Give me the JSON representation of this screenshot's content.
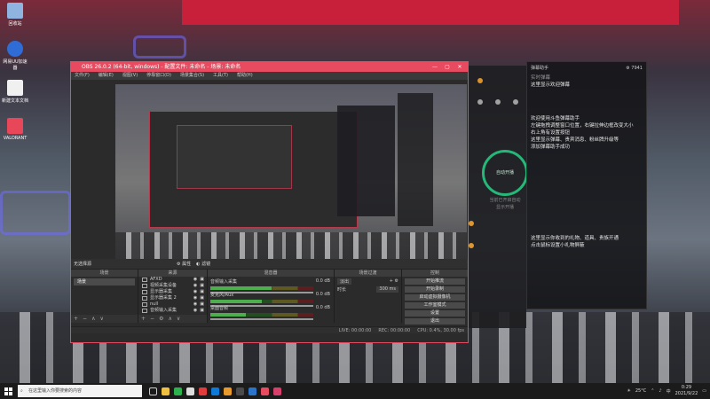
{
  "desktop": {
    "icons": [
      {
        "label": "回收站",
        "color": "#8fb4e0"
      },
      {
        "label": "网易UU加速器",
        "color": "#2f6cd6"
      },
      {
        "label": "新建文本文档",
        "color": "#f0f0f0"
      },
      {
        "label": "VALORANT",
        "color": "#e8475a"
      }
    ]
  },
  "obs": {
    "title": "OBS 26.0.2 (64-bit, windows) - 配置文件: 未命名 - 场景: 未命名",
    "window_controls": [
      "—",
      "▢",
      "✕"
    ],
    "menu": [
      "文件(F)",
      "编辑(E)",
      "视图(V)",
      "停靠窗口(D)",
      "场景集合(S)",
      "工具(T)",
      "帮助(H)"
    ],
    "scene_bar_label": "无选择源",
    "scene_bar_props": "属性",
    "scene_bar_filters": "滤镜",
    "docks": {
      "scenes": {
        "header": "场景",
        "items": [
          "场景"
        ]
      },
      "sources": {
        "header": "来源",
        "items": [
          "AFXD",
          "视频采集设备",
          "显示器采集",
          "显示器采集 2",
          "null",
          "音频输入采集"
        ]
      },
      "mixer": {
        "header": "混音器",
        "rows": [
          {
            "name": "音频输入采集",
            "value": "0.0 dB",
            "level": 0.6
          },
          {
            "name": "麦克风/Aux",
            "value": "0.0 dB",
            "level": 0.5
          },
          {
            "name": "桌面音频",
            "value": "0.0 dB",
            "level": 0.35
          }
        ]
      },
      "transitions": {
        "header": "场景过渡",
        "type": "淡出",
        "duration_label": "时长",
        "duration_value": "300 ms"
      },
      "controls": {
        "header": "控制",
        "buttons": [
          "开始推流",
          "开始录制",
          "启动虚拟摄像机",
          "工作室模式",
          "设置",
          "退出"
        ]
      }
    },
    "status": {
      "live": "LIVE: 00:00:00",
      "rec": "REC: 00:00:00",
      "cpu": "CPU: 0.4%, 30.00 fps"
    }
  },
  "chatapp": {
    "circle_label": "自动开播",
    "hint1": "当前已开启自动",
    "hint2": "显示开播"
  },
  "assistant": {
    "title": "弹幕助手",
    "top_right": "7941",
    "header_line": "实时弹幕",
    "msg_welcome": "这里显示欢迎弹幕",
    "lines": [
      "欢迎使用斗鱼弹幕助手",
      "左键拖拽调整窗口位置，右键拉伸边框改变大小",
      "右上角有设置按钮",
      "这里显示弹幕、贵宾消息、粉丝牌升级等",
      "添加弹幕助手成功"
    ],
    "gift_hint": "这里显示你收到的礼物、道具、贵族开通",
    "gift_hint2": "点击鼠标设置小礼物屏蔽"
  },
  "taskbar": {
    "search_placeholder": "在这里输入你要搜索的内容",
    "temperature": "25°C",
    "ime": "中",
    "time": "0:29",
    "date": "2021/9/22"
  }
}
